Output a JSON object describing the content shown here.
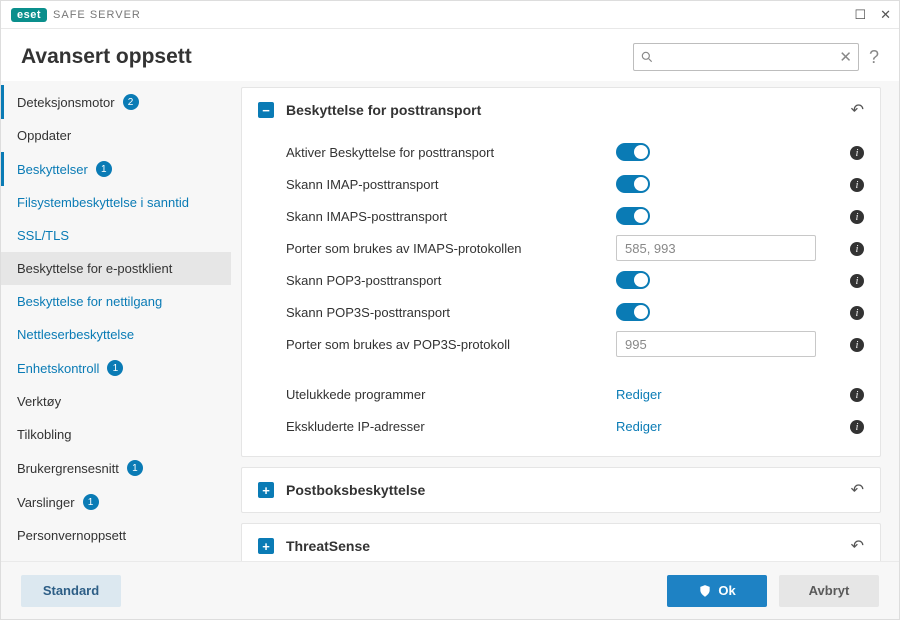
{
  "titlebar": {
    "brand": "eset",
    "product": "SAFE SERVER"
  },
  "header": {
    "title": "Avansert oppsett",
    "search_placeholder": "",
    "help": "?"
  },
  "sidebar": [
    {
      "id": "detection",
      "label": "Deteksjonsmotor",
      "badge": "2",
      "type": "top",
      "withbar": true
    },
    {
      "id": "updater",
      "label": "Oppdater",
      "type": "top"
    },
    {
      "id": "protect",
      "label": "Beskyttelser",
      "badge": "1",
      "type": "top",
      "active": true
    },
    {
      "id": "fs",
      "label": "Filsystembeskyttelse i sanntid",
      "type": "sub"
    },
    {
      "id": "ssl",
      "label": "SSL/TLS",
      "type": "sub"
    },
    {
      "id": "mail",
      "label": "Beskyttelse for e-postklient",
      "type": "sub",
      "selected": true
    },
    {
      "id": "net",
      "label": "Beskyttelse for nettilgang",
      "type": "sub"
    },
    {
      "id": "browser",
      "label": "Nettleserbeskyttelse",
      "type": "sub"
    },
    {
      "id": "device",
      "label": "Enhetskontroll",
      "badge": "1",
      "type": "sub"
    },
    {
      "id": "tools",
      "label": "Verktøy",
      "type": "top"
    },
    {
      "id": "conn",
      "label": "Tilkobling",
      "type": "top"
    },
    {
      "id": "ui",
      "label": "Brukergrensesnitt",
      "badge": "1",
      "type": "top"
    },
    {
      "id": "notif",
      "label": "Varslinger",
      "badge": "1",
      "type": "top"
    },
    {
      "id": "privacy",
      "label": "Personvernoppsett",
      "type": "top"
    }
  ],
  "panels": {
    "transport": {
      "title": "Beskyttelse for posttransport",
      "expanded": true,
      "rows": [
        {
          "id": "enable",
          "label": "Aktiver Beskyttelse for posttransport",
          "type": "switch",
          "on": true
        },
        {
          "id": "imap",
          "label": "Skann IMAP-posttransport",
          "type": "switch",
          "on": true
        },
        {
          "id": "imaps",
          "label": "Skann IMAPS-posttransport",
          "type": "switch",
          "on": true
        },
        {
          "id": "imaps_ports",
          "label": "Porter som brukes av IMAPS-protokollen",
          "type": "text",
          "value": "585, 993"
        },
        {
          "id": "pop3",
          "label": "Skann POP3-posttransport",
          "type": "switch",
          "on": true
        },
        {
          "id": "pop3s",
          "label": "Skann POP3S-posttransport",
          "type": "switch",
          "on": true
        },
        {
          "id": "pop3s_ports",
          "label": "Porter som brukes av POP3S-protokoll",
          "type": "text",
          "value": "995"
        },
        {
          "id": "spacer",
          "type": "spacer"
        },
        {
          "id": "excl_apps",
          "label": "Utelukkede programmer",
          "type": "link",
          "link": "Rediger"
        },
        {
          "id": "excl_ips",
          "label": "Ekskluderte IP-adresser",
          "type": "link",
          "link": "Rediger"
        }
      ]
    },
    "mailbox": {
      "title": "Postboksbeskyttelse",
      "expanded": false
    },
    "threatsense": {
      "title": "ThreatSense",
      "expanded": false
    }
  },
  "footer": {
    "default": "Standard",
    "ok": "Ok",
    "cancel": "Avbryt"
  }
}
